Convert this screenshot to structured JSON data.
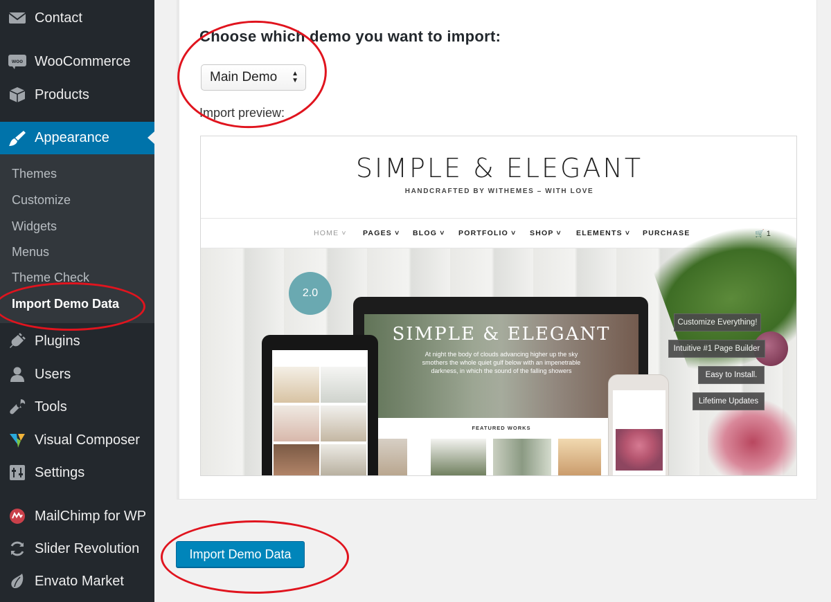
{
  "sidebar": {
    "items": [
      {
        "label": "Contact",
        "icon": "envelope-icon"
      },
      {
        "label": "WooCommerce",
        "icon": "woocommerce-icon"
      },
      {
        "label": "Products",
        "icon": "box-icon"
      },
      {
        "label": "Appearance",
        "icon": "paintbrush-icon",
        "current": true
      },
      {
        "label": "Plugins",
        "icon": "plug-icon"
      },
      {
        "label": "Users",
        "icon": "user-icon"
      },
      {
        "label": "Tools",
        "icon": "wrench-icon"
      },
      {
        "label": "Visual Composer",
        "icon": "visual-composer-icon"
      },
      {
        "label": "Settings",
        "icon": "settings-sliders-icon"
      },
      {
        "label": "MailChimp for WP",
        "icon": "mailchimp-icon"
      },
      {
        "label": "Slider Revolution",
        "icon": "refresh-icon"
      },
      {
        "label": "Envato Market",
        "icon": "leaf-icon"
      }
    ],
    "submenu": [
      "Themes",
      "Customize",
      "Widgets",
      "Menus",
      "Theme Check",
      "Import Demo Data"
    ]
  },
  "main": {
    "heading": "Choose which demo you want to import:",
    "select_value": "Main Demo",
    "preview_label": "Import preview:",
    "import_button": "Import Demo Data"
  },
  "preview": {
    "site_title": "SIMPLE & ELEGANT",
    "tagline": "HANDCRAFTED BY WITHEMES – WITH LOVE",
    "nav": [
      "HOME",
      "PAGES",
      "BLOG",
      "PORTFOLIO",
      "SHOP",
      "ELEMENTS",
      "PURCHASE"
    ],
    "cart_count": "1",
    "badge": "2.0",
    "laptop_title": "SIMPLE & ELEGANT",
    "laptop_text": "At night the body of clouds advancing higher up the sky smothers the whole quiet gulf below with an impenetrable darkness, in which the sound of the falling showers",
    "featured": "FEATURED WORKS",
    "tags": [
      "Customize Everything!",
      "Intuitive #1 Page Builder",
      "Easy to Install.",
      "Lifetime Updates"
    ]
  },
  "colors": {
    "sidebar_bg": "#23282d",
    "submenu_bg": "#32373c",
    "accent": "#0073aa",
    "button": "#0085ba",
    "annotation": "#e0141e"
  }
}
